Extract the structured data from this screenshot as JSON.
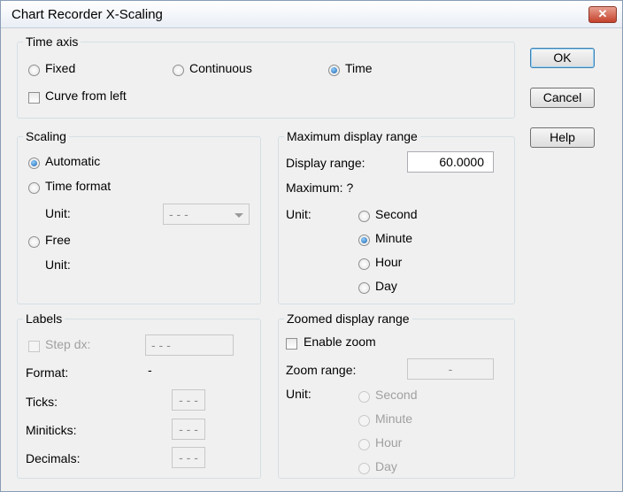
{
  "window": {
    "title": "Chart Recorder X-Scaling",
    "close_glyph": "✕"
  },
  "time_axis": {
    "legend": "Time axis",
    "options": {
      "fixed": "Fixed",
      "continuous": "Continuous",
      "time": "Time"
    },
    "selected": "Time",
    "curve_from_left": "Curve from left"
  },
  "scaling": {
    "legend": "Scaling",
    "automatic": "Automatic",
    "time_format": "Time format",
    "unit_label": "Unit:",
    "unit_value": "- - -",
    "free": "Free",
    "free_unit_label": "Unit:",
    "selected": "Automatic"
  },
  "max_range": {
    "legend": "Maximum display range",
    "display_range_label": "Display range:",
    "display_range_value": "60.0000",
    "maximum_label": "Maximum:  ?",
    "unit_label": "Unit:",
    "units": [
      "Second",
      "Minute",
      "Hour",
      "Day"
    ],
    "selected": "Minute"
  },
  "labels": {
    "legend": "Labels",
    "step_dx": "Step dx:",
    "step_dx_value": "- - -",
    "format_label": "Format:",
    "format_value": "-",
    "ticks_label": "Ticks:",
    "ticks_value": "- - -",
    "miniticks_label": "Miniticks:",
    "miniticks_value": "- - -",
    "decimals_label": "Decimals:",
    "decimals_value": "- - -"
  },
  "zoom": {
    "legend": "Zoomed display range",
    "enable_zoom": "Enable zoom",
    "zoom_range_label": "Zoom range:",
    "zoom_range_value": "-",
    "unit_label": "Unit:",
    "units": [
      "Second",
      "Minute",
      "Hour",
      "Day"
    ]
  },
  "buttons": {
    "ok": "OK",
    "cancel": "Cancel",
    "help": "Help"
  }
}
